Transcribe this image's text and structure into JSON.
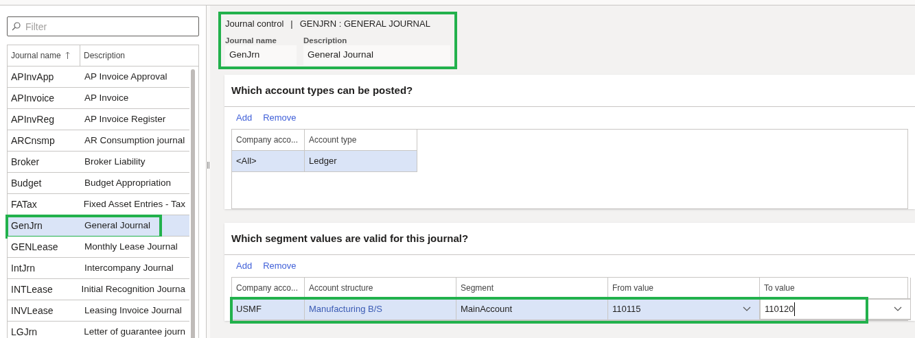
{
  "filter": {
    "placeholder": "Filter"
  },
  "journal_list": {
    "columns": [
      {
        "label": "Journal name",
        "sorted": true
      },
      {
        "label": "Description",
        "sorted": false
      }
    ],
    "rows": [
      {
        "name": "APInvApp",
        "description": "AP Invoice Approval",
        "selected": false,
        "highlighted": false
      },
      {
        "name": "APInvoice",
        "description": "AP Invoice",
        "selected": false,
        "highlighted": false
      },
      {
        "name": "APInvReg",
        "description": "AP Invoice Register",
        "selected": false,
        "highlighted": false
      },
      {
        "name": "ARCnsmp",
        "description": "AR Consumption journal",
        "selected": false,
        "highlighted": false
      },
      {
        "name": "Broker",
        "description": "Broker Liability",
        "selected": false,
        "highlighted": false
      },
      {
        "name": "Budget",
        "description": "Budget Appropriation",
        "selected": false,
        "highlighted": false
      },
      {
        "name": "FATax",
        "description": "Fixed Asset Entries - Tax",
        "selected": false,
        "highlighted": false
      },
      {
        "name": "GenJrn",
        "description": "General Journal",
        "selected": true,
        "highlighted": true
      },
      {
        "name": "GENLease",
        "description": "Monthly Lease Journal",
        "selected": false,
        "highlighted": false
      },
      {
        "name": "IntJrn",
        "description": "Intercompany Journal",
        "selected": false,
        "highlighted": false
      },
      {
        "name": "INTLease",
        "description": "Initial Recognition Journa",
        "selected": false,
        "highlighted": false
      },
      {
        "name": "INVLease",
        "description": "Leasing Invoice Journal",
        "selected": false,
        "highlighted": false
      },
      {
        "name": "LGJrn",
        "description": "Letter of guarantee journ",
        "selected": false,
        "highlighted": false
      }
    ]
  },
  "header": {
    "caption": "Journal control",
    "separator": "|",
    "title": "GENJRN : GENERAL JOURNAL",
    "highlighted": true,
    "fields": [
      {
        "label": "Journal name",
        "value": "GenJrn"
      },
      {
        "label": "Description",
        "value": "General Journal"
      }
    ]
  },
  "sections": [
    {
      "title": "Which account types can be posted?",
      "actions": [
        "Add",
        "Remove"
      ],
      "table": {
        "columns": [
          "Company acco...",
          "Account type"
        ],
        "rows": [
          {
            "selected": true,
            "highlighted": false,
            "cells": [
              {
                "kind": "text",
                "value": "<All>"
              },
              {
                "kind": "text",
                "value": "Ledger"
              }
            ]
          }
        ]
      }
    },
    {
      "title": "Which segment values are valid for this journal?",
      "actions": [
        "Add",
        "Remove"
      ],
      "table": {
        "columns": [
          "Company acco...",
          "Account structure",
          "Segment",
          "From value",
          "To value"
        ],
        "rows": [
          {
            "selected": true,
            "highlighted": true,
            "cells": [
              {
                "kind": "text",
                "value": "USMF"
              },
              {
                "kind": "link",
                "value": "Manufacturing B/S"
              },
              {
                "kind": "text",
                "value": "MainAccount"
              },
              {
                "kind": "dropdown",
                "value": "110115"
              },
              {
                "kind": "input",
                "value": "110120"
              }
            ]
          }
        ]
      }
    }
  ]
}
